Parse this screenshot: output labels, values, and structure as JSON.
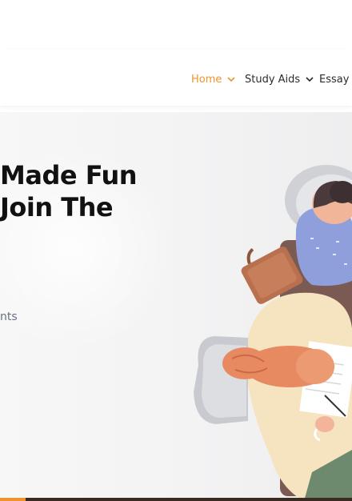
{
  "nav": {
    "items": [
      {
        "label": "Home",
        "active": true
      },
      {
        "label": "Study Aids",
        "active": false
      },
      {
        "label": "Essay",
        "active": false
      }
    ]
  },
  "hero": {
    "headline_line1": "Made Fun",
    "headline_line2": "Join The",
    "subtext": "nts"
  },
  "colors": {
    "accent": "#f0932b",
    "text": "#111111",
    "muted": "#6a7080"
  },
  "icons": [
    "chevron-down-icon",
    "study-illustration"
  ]
}
